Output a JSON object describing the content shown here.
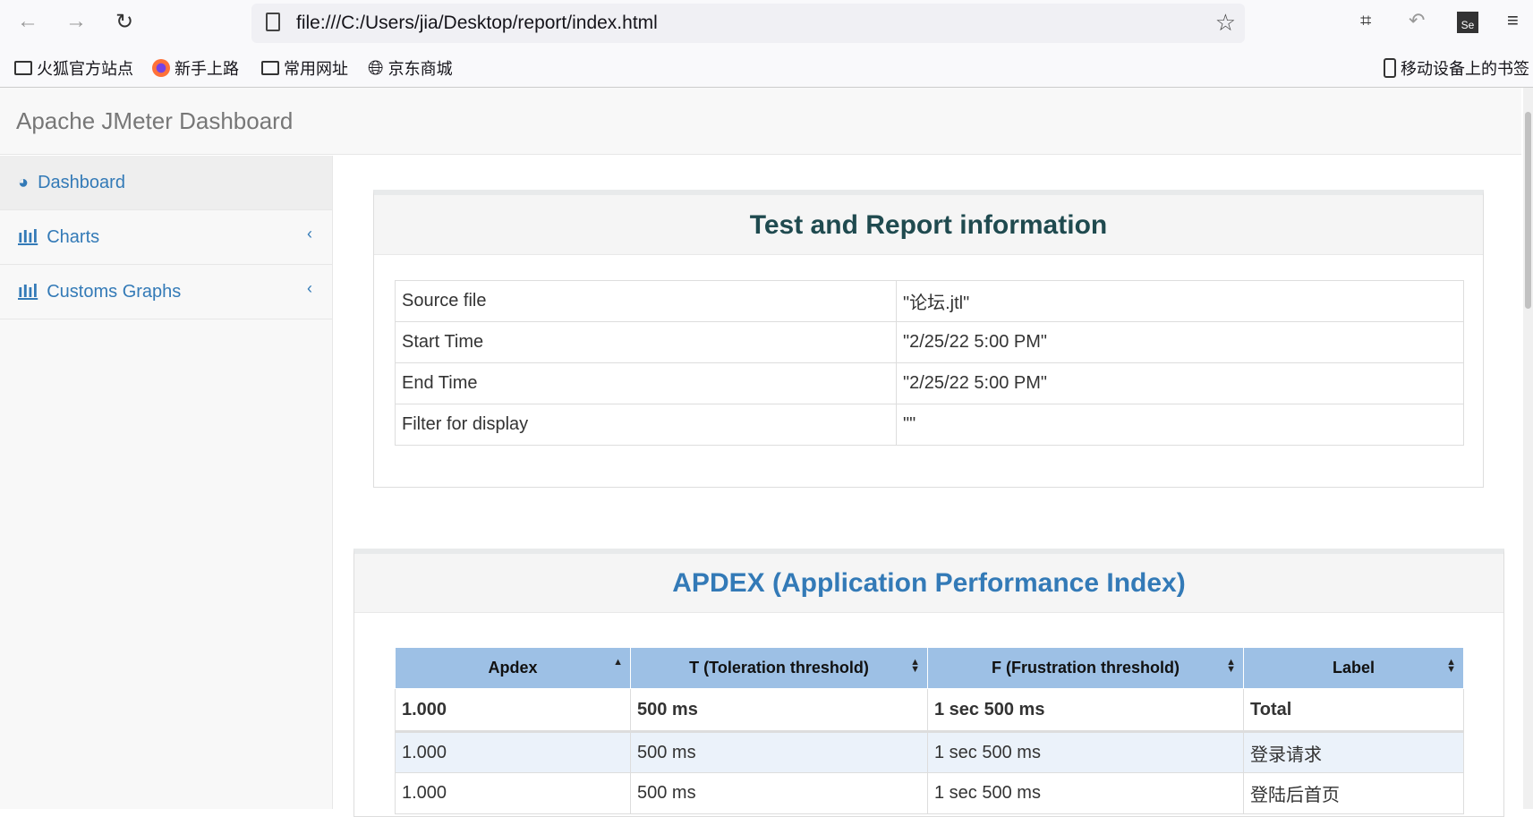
{
  "browser": {
    "url": "file:///C:/Users/jia/Desktop/report/index.html",
    "bookmarks": [
      {
        "label": "火狐官方站点",
        "icon": "folder-icon"
      },
      {
        "label": "新手上路",
        "icon": "firefox-icon"
      },
      {
        "label": "常用网址",
        "icon": "folder-icon"
      },
      {
        "label": "京东商城",
        "icon": "globe-icon"
      }
    ],
    "mobile_bookmarks": "移动设备上的书签"
  },
  "header": {
    "title": "Apache JMeter Dashboard"
  },
  "sidebar": {
    "items": [
      {
        "label": "Dashboard",
        "icon": "dashboard-icon"
      },
      {
        "label": "Charts",
        "icon": "bar-chart-icon"
      },
      {
        "label": "Customs Graphs",
        "icon": "bar-chart-icon"
      }
    ]
  },
  "info": {
    "title": "Test and Report information",
    "rows": [
      [
        "Source file",
        "\"论坛.jtl\""
      ],
      [
        "Start Time",
        "\"2/25/22 5:00 PM\""
      ],
      [
        "End Time",
        "\"2/25/22 5:00 PM\""
      ],
      [
        "Filter for display",
        "\"\""
      ]
    ]
  },
  "apdex": {
    "title": "APDEX (Application Performance Index)",
    "headers": [
      "Apdex",
      "T (Toleration threshold)",
      "F (Frustration threshold)",
      "Label"
    ],
    "rows": [
      [
        "1.000",
        "500 ms",
        "1 sec 500 ms",
        "Total"
      ],
      [
        "1.000",
        "500 ms",
        "1 sec 500 ms",
        "登录请求"
      ],
      [
        "1.000",
        "500 ms",
        "1 sec 500 ms",
        "登陆后首页"
      ]
    ]
  },
  "colors": {
    "link": "#337ab7",
    "header_bg": "#9dc0e5",
    "title_dark": "#1f4a4f"
  }
}
